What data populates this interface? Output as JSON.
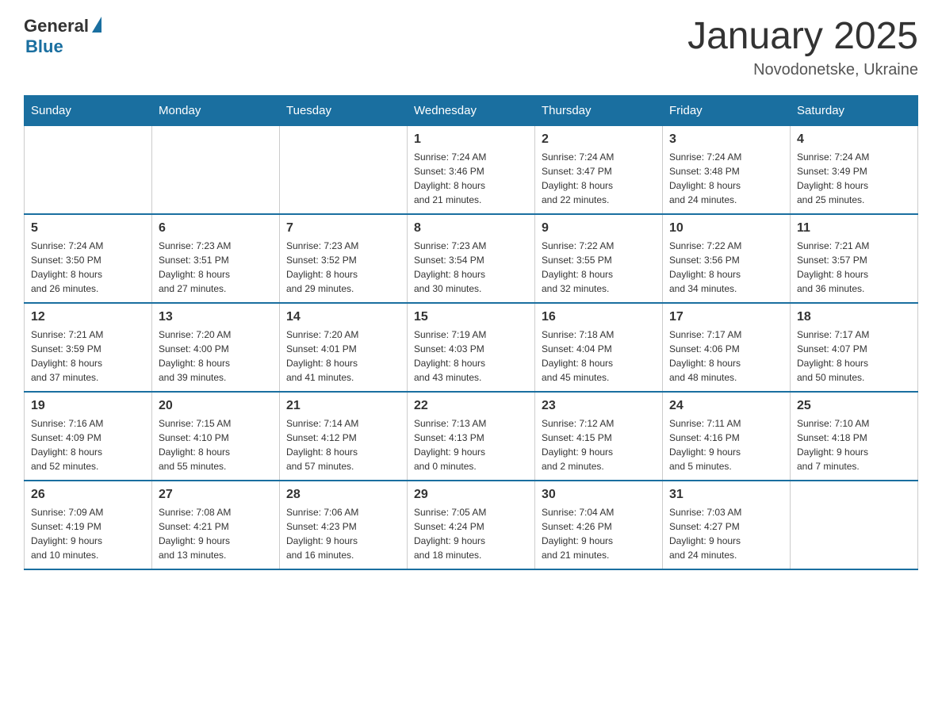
{
  "logo": {
    "general": "General",
    "blue": "Blue"
  },
  "title": "January 2025",
  "location": "Novodonetske, Ukraine",
  "days_of_week": [
    "Sunday",
    "Monday",
    "Tuesday",
    "Wednesday",
    "Thursday",
    "Friday",
    "Saturday"
  ],
  "weeks": [
    [
      {
        "day": "",
        "info": ""
      },
      {
        "day": "",
        "info": ""
      },
      {
        "day": "",
        "info": ""
      },
      {
        "day": "1",
        "info": "Sunrise: 7:24 AM\nSunset: 3:46 PM\nDaylight: 8 hours\nand 21 minutes."
      },
      {
        "day": "2",
        "info": "Sunrise: 7:24 AM\nSunset: 3:47 PM\nDaylight: 8 hours\nand 22 minutes."
      },
      {
        "day": "3",
        "info": "Sunrise: 7:24 AM\nSunset: 3:48 PM\nDaylight: 8 hours\nand 24 minutes."
      },
      {
        "day": "4",
        "info": "Sunrise: 7:24 AM\nSunset: 3:49 PM\nDaylight: 8 hours\nand 25 minutes."
      }
    ],
    [
      {
        "day": "5",
        "info": "Sunrise: 7:24 AM\nSunset: 3:50 PM\nDaylight: 8 hours\nand 26 minutes."
      },
      {
        "day": "6",
        "info": "Sunrise: 7:23 AM\nSunset: 3:51 PM\nDaylight: 8 hours\nand 27 minutes."
      },
      {
        "day": "7",
        "info": "Sunrise: 7:23 AM\nSunset: 3:52 PM\nDaylight: 8 hours\nand 29 minutes."
      },
      {
        "day": "8",
        "info": "Sunrise: 7:23 AM\nSunset: 3:54 PM\nDaylight: 8 hours\nand 30 minutes."
      },
      {
        "day": "9",
        "info": "Sunrise: 7:22 AM\nSunset: 3:55 PM\nDaylight: 8 hours\nand 32 minutes."
      },
      {
        "day": "10",
        "info": "Sunrise: 7:22 AM\nSunset: 3:56 PM\nDaylight: 8 hours\nand 34 minutes."
      },
      {
        "day": "11",
        "info": "Sunrise: 7:21 AM\nSunset: 3:57 PM\nDaylight: 8 hours\nand 36 minutes."
      }
    ],
    [
      {
        "day": "12",
        "info": "Sunrise: 7:21 AM\nSunset: 3:59 PM\nDaylight: 8 hours\nand 37 minutes."
      },
      {
        "day": "13",
        "info": "Sunrise: 7:20 AM\nSunset: 4:00 PM\nDaylight: 8 hours\nand 39 minutes."
      },
      {
        "day": "14",
        "info": "Sunrise: 7:20 AM\nSunset: 4:01 PM\nDaylight: 8 hours\nand 41 minutes."
      },
      {
        "day": "15",
        "info": "Sunrise: 7:19 AM\nSunset: 4:03 PM\nDaylight: 8 hours\nand 43 minutes."
      },
      {
        "day": "16",
        "info": "Sunrise: 7:18 AM\nSunset: 4:04 PM\nDaylight: 8 hours\nand 45 minutes."
      },
      {
        "day": "17",
        "info": "Sunrise: 7:17 AM\nSunset: 4:06 PM\nDaylight: 8 hours\nand 48 minutes."
      },
      {
        "day": "18",
        "info": "Sunrise: 7:17 AM\nSunset: 4:07 PM\nDaylight: 8 hours\nand 50 minutes."
      }
    ],
    [
      {
        "day": "19",
        "info": "Sunrise: 7:16 AM\nSunset: 4:09 PM\nDaylight: 8 hours\nand 52 minutes."
      },
      {
        "day": "20",
        "info": "Sunrise: 7:15 AM\nSunset: 4:10 PM\nDaylight: 8 hours\nand 55 minutes."
      },
      {
        "day": "21",
        "info": "Sunrise: 7:14 AM\nSunset: 4:12 PM\nDaylight: 8 hours\nand 57 minutes."
      },
      {
        "day": "22",
        "info": "Sunrise: 7:13 AM\nSunset: 4:13 PM\nDaylight: 9 hours\nand 0 minutes."
      },
      {
        "day": "23",
        "info": "Sunrise: 7:12 AM\nSunset: 4:15 PM\nDaylight: 9 hours\nand 2 minutes."
      },
      {
        "day": "24",
        "info": "Sunrise: 7:11 AM\nSunset: 4:16 PM\nDaylight: 9 hours\nand 5 minutes."
      },
      {
        "day": "25",
        "info": "Sunrise: 7:10 AM\nSunset: 4:18 PM\nDaylight: 9 hours\nand 7 minutes."
      }
    ],
    [
      {
        "day": "26",
        "info": "Sunrise: 7:09 AM\nSunset: 4:19 PM\nDaylight: 9 hours\nand 10 minutes."
      },
      {
        "day": "27",
        "info": "Sunrise: 7:08 AM\nSunset: 4:21 PM\nDaylight: 9 hours\nand 13 minutes."
      },
      {
        "day": "28",
        "info": "Sunrise: 7:06 AM\nSunset: 4:23 PM\nDaylight: 9 hours\nand 16 minutes."
      },
      {
        "day": "29",
        "info": "Sunrise: 7:05 AM\nSunset: 4:24 PM\nDaylight: 9 hours\nand 18 minutes."
      },
      {
        "day": "30",
        "info": "Sunrise: 7:04 AM\nSunset: 4:26 PM\nDaylight: 9 hours\nand 21 minutes."
      },
      {
        "day": "31",
        "info": "Sunrise: 7:03 AM\nSunset: 4:27 PM\nDaylight: 9 hours\nand 24 minutes."
      },
      {
        "day": "",
        "info": ""
      }
    ]
  ]
}
